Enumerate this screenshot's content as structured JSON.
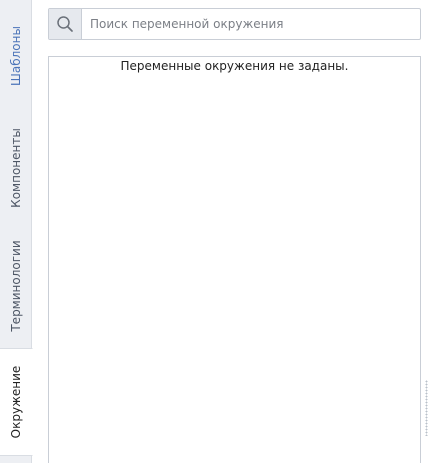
{
  "sidebar": {
    "tabs": [
      {
        "label": "Шаблоны",
        "active": false
      },
      {
        "label": "Компоненты",
        "active": false
      },
      {
        "label": "Терминологии",
        "active": false
      },
      {
        "label": "Окружение",
        "active": true
      }
    ]
  },
  "search": {
    "placeholder": "Поиск переменной окружения",
    "value": "",
    "icon": "search-icon"
  },
  "panel": {
    "empty_message": "Переменные окружения не заданы."
  },
  "colors": {
    "accent": "#4b74b9",
    "tab_strip_bg": "#edeff3",
    "border": "#c9ced6"
  }
}
